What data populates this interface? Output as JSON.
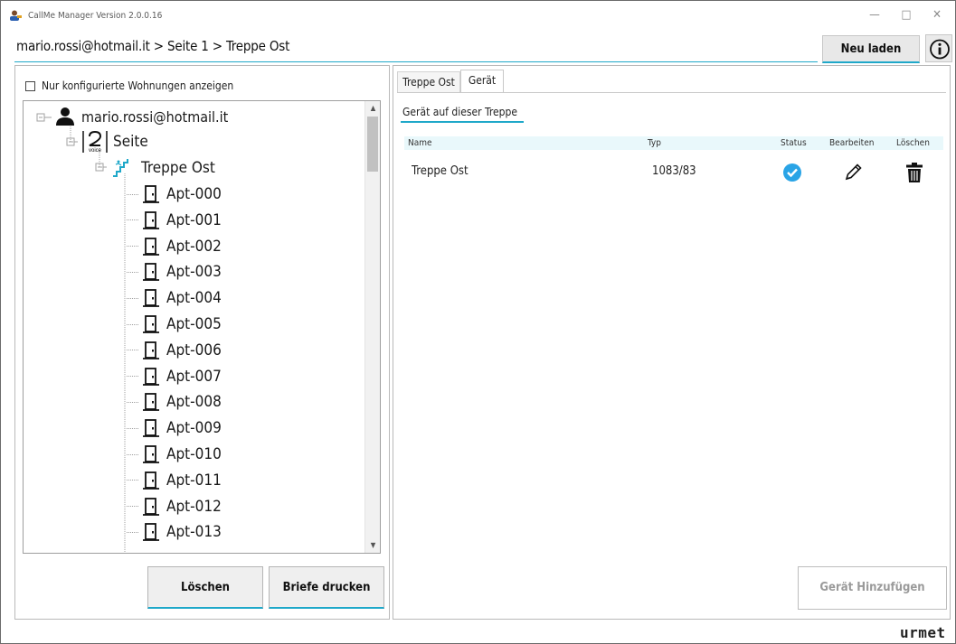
{
  "window": {
    "title": "CallMe Manager Version 2.0.0.16"
  },
  "breadcrumb": "mario.rossi@hotmail.it > Seite 1 > Treppe Ost",
  "toolbar": {
    "reload_label": "Neu laden"
  },
  "left": {
    "filter_label": "Nur konfigurierte Wohnungen anzeigen",
    "tree": {
      "root": "mario.rossi@hotmail.it",
      "page": "Seite",
      "stair": "Treppe Ost",
      "apartments": [
        "Apt-000",
        "Apt-001",
        "Apt-002",
        "Apt-003",
        "Apt-004",
        "Apt-005",
        "Apt-006",
        "Apt-007",
        "Apt-008",
        "Apt-009",
        "Apt-010",
        "Apt-011",
        "Apt-012",
        "Apt-013"
      ]
    },
    "delete_label": "Löschen",
    "print_label": "Briefe drucken"
  },
  "right": {
    "tabs": [
      {
        "label": "Treppe Ost"
      },
      {
        "label": "Gerät"
      }
    ],
    "section_title": "Gerät auf dieser Treppe",
    "columns": {
      "name": "Name",
      "type": "Typ",
      "status": "Status",
      "edit": "Bearbeiten",
      "delete": "Löschen"
    },
    "rows": [
      {
        "name": "Treppe Ost",
        "type": "1083/83",
        "status": "check-circle-icon",
        "edit": "pencil-icon",
        "delete": "trash-icon"
      }
    ],
    "add_label": "Gerät Hinzufügen"
  },
  "brand": "urmet",
  "colors": {
    "accent": "#1fa8c9",
    "status_ok": "#2aa4e6"
  }
}
